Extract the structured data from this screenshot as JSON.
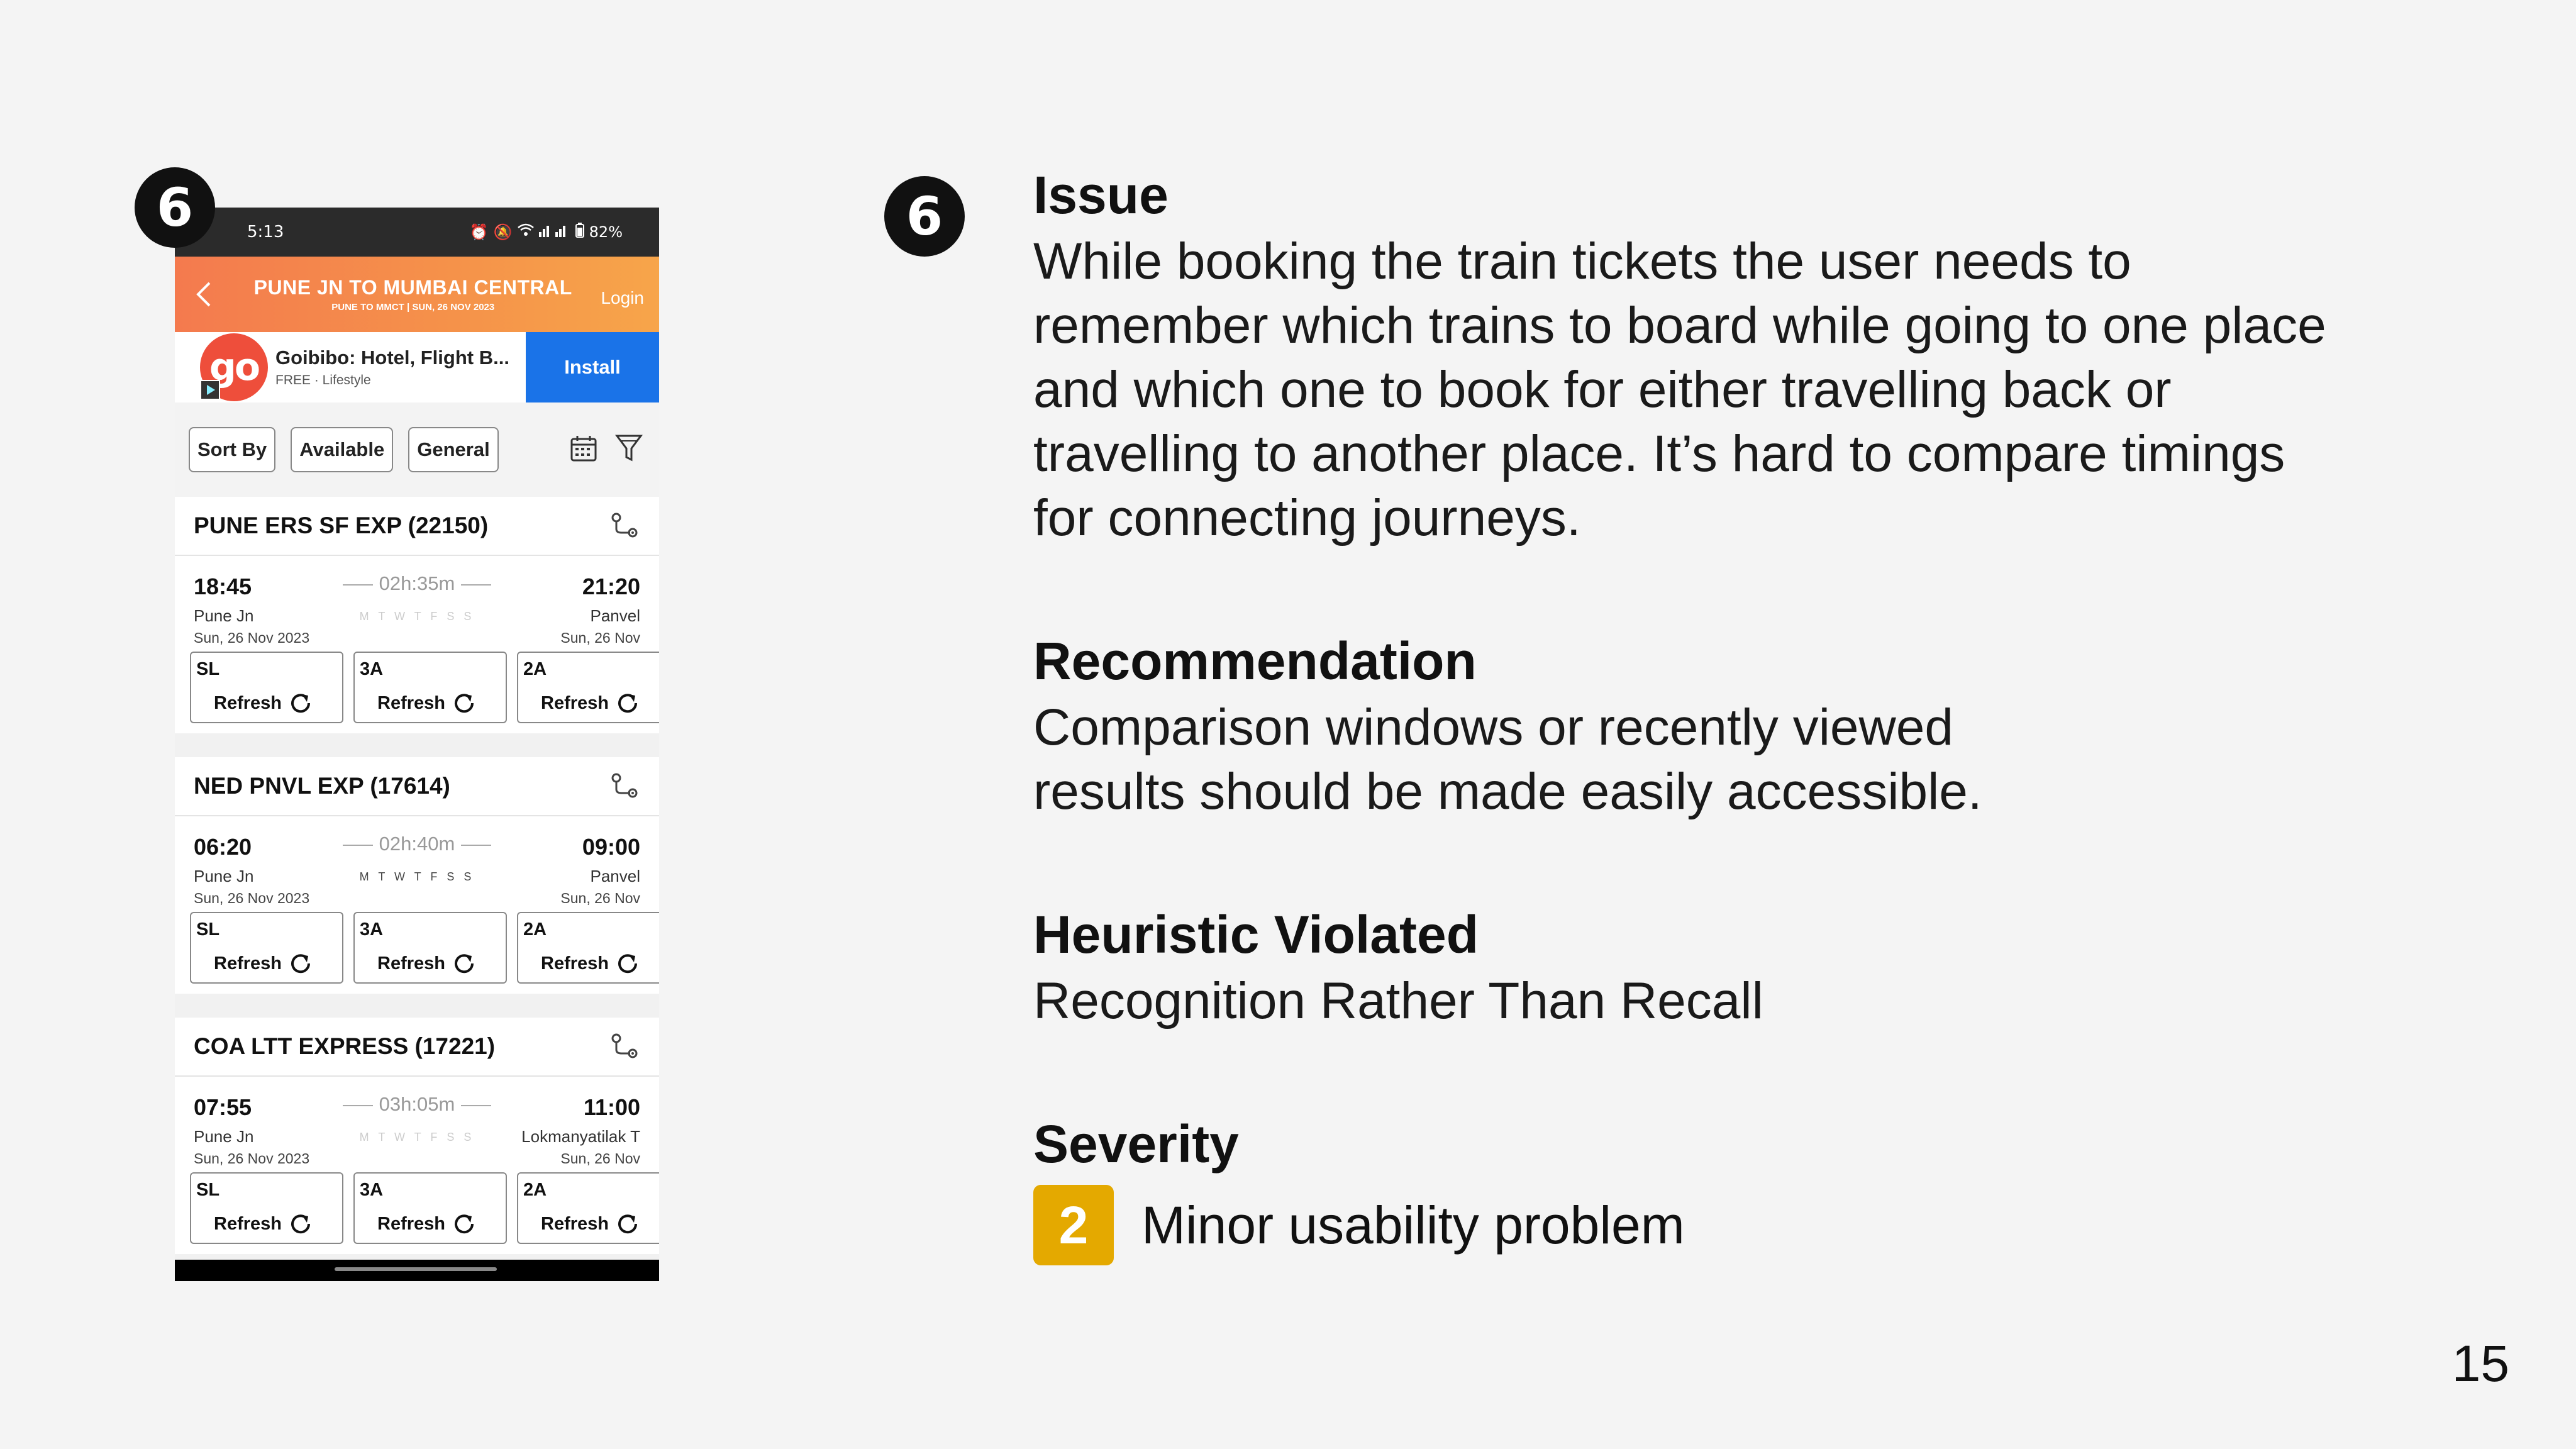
{
  "issue_number": "6",
  "phone": {
    "status_bar": {
      "time": "5:13",
      "battery": "82%"
    },
    "header": {
      "title": "PUNE JN TO MUMBAI CENTRAL",
      "subtitle": "PUNE TO MMCT | SUN, 26 NOV 2023",
      "login_label": "Login"
    },
    "ad": {
      "logo_text": "go",
      "name": "Goibibo: Hotel, Flight B...",
      "meta": "FREE · Lifestyle",
      "install_label": "Install"
    },
    "filters": {
      "sort_by": "Sort By",
      "available": "Available",
      "general": "General"
    },
    "trains": [
      {
        "name": "PUNE ERS SF EXP (22150)",
        "departure_time": "18:45",
        "arrival_time": "21:20",
        "duration": "02h:35m",
        "from_station": "Pune Jn",
        "from_date": "Sun, 26 Nov  2023",
        "to_station": "Panvel",
        "to_date": "Sun, 26 Nov",
        "days": "M T W T F S S",
        "classes": [
          {
            "code": "SL",
            "action": "Refresh"
          },
          {
            "code": "3A",
            "action": "Refresh"
          },
          {
            "code": "2A",
            "action": "Refresh"
          }
        ]
      },
      {
        "name": "NED PNVL EXP (17614)",
        "departure_time": "06:20",
        "arrival_time": "09:00",
        "duration": "02h:40m",
        "from_station": "Pune Jn",
        "from_date": "Sun, 26 Nov  2023",
        "to_station": "Panvel",
        "to_date": "Sun, 26 Nov",
        "days": "M T W T F S S",
        "classes": [
          {
            "code": "SL",
            "action": "Refresh"
          },
          {
            "code": "3A",
            "action": "Refresh"
          },
          {
            "code": "2A",
            "action": "Refresh"
          }
        ]
      },
      {
        "name": "COA LTT EXPRESS (17221)",
        "departure_time": "07:55",
        "arrival_time": "11:00",
        "duration": "03h:05m",
        "from_station": "Pune Jn",
        "from_date": "Sun, 26 Nov  2023",
        "to_station": "Lokmanyatilak T",
        "to_date": "Sun, 26 Nov",
        "days": "M T W T F S S",
        "classes": [
          {
            "code": "SL",
            "action": "Refresh"
          },
          {
            "code": "3A",
            "action": "Refresh"
          },
          {
            "code": "2A",
            "action": "Refresh"
          }
        ]
      }
    ]
  },
  "issue": {
    "title": "Issue",
    "body": "While booking the train tickets the user needs to remember which trains to board while going to one place and which one to book for either travelling back or travelling to another place. It’s hard to compare timings for connecting journeys."
  },
  "recommendation": {
    "title": "Recommendation",
    "body": "Comparison windows or recently viewed results should be made easily accessible."
  },
  "heuristic": {
    "title": "Heuristic Violated",
    "body": "Recognition Rather Than Recall"
  },
  "severity": {
    "title": "Severity",
    "level": "2",
    "label": "Minor usability problem",
    "color": "#e4a900"
  },
  "page_number": "15"
}
